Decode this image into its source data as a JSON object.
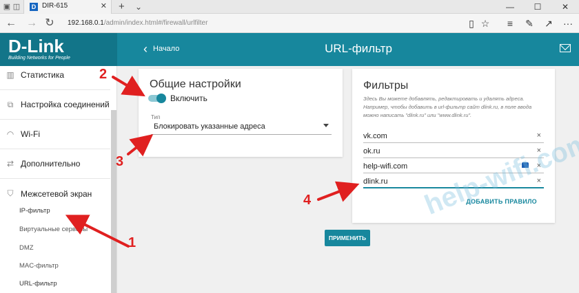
{
  "browser": {
    "tab_title": "DIR-615",
    "tab_favicon": "D",
    "url_main": "192.168.0.1",
    "url_path": "/admin/index.html#/firewall/urlfilter",
    "new_tab": "+",
    "tab_list": "⌄"
  },
  "header": {
    "logo": "D-Link",
    "tagline": "Building Networks for People",
    "back_label": "Начало",
    "title": "URL-фильтр"
  },
  "sidebar": {
    "items": [
      {
        "label": "Статистика",
        "icon": "chart-icon"
      },
      {
        "label": "Настройка соединений",
        "icon": "connections-icon"
      },
      {
        "label": "Wi-Fi",
        "icon": "wifi-icon"
      },
      {
        "label": "Дополнительно",
        "icon": "sliders-icon"
      },
      {
        "label": "Межсетевой экран",
        "icon": "shield-icon"
      }
    ],
    "subitems": [
      "IP-фильтр",
      "Виртуальные серверы",
      "DMZ",
      "MAC-фильтр",
      "URL-фильтр"
    ]
  },
  "general": {
    "title": "Общие настройки",
    "toggle_label": "Включить",
    "type_label": "Тип",
    "type_value": "Блокировать указанные адреса"
  },
  "filters": {
    "title": "Фильтры",
    "description": "Здесь Вы можете добавлять, редактировать и удалять адреса. Например, чтобы добавить в url-фильтр сайт dlink.ru, в поле ввода можно написать \"dlink.ru\" или \"www.dlink.ru\".",
    "urls": [
      "vk.com",
      "ok.ru",
      "help-wifi.com",
      "dlink.ru"
    ],
    "add_rule": "ДОБАВИТЬ ПРАВИЛО"
  },
  "apply_label": "ПРИМЕНИТЬ",
  "annotations": [
    "1",
    "2",
    "3",
    "4"
  ],
  "watermark": "help-wifi.com",
  "colors": {
    "accent": "#17879d",
    "arrow": "#e02020"
  }
}
